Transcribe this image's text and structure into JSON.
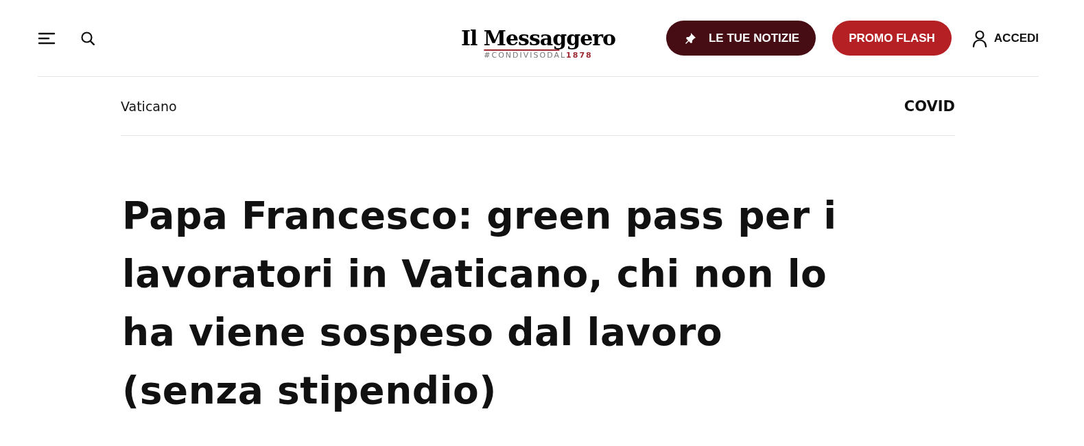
{
  "header": {
    "logo": {
      "name": "Il Messaggero",
      "tagline": "#CONDIVISODAL",
      "year": "1878"
    },
    "buttons": [
      {
        "kind": "news",
        "label": "LE TUE NOTIZIE"
      },
      {
        "kind": "promo",
        "label": "PROMO FLASH"
      }
    ],
    "login": "ACCEDI"
  },
  "section_bar": {
    "section": "Vaticano",
    "tag": "COVID"
  },
  "article": {
    "headline": "Papa Francesco: green pass per i lavoratori in Vaticano, chi non lo ha viene sospeso dal lavoro (senza stipendio)"
  }
}
